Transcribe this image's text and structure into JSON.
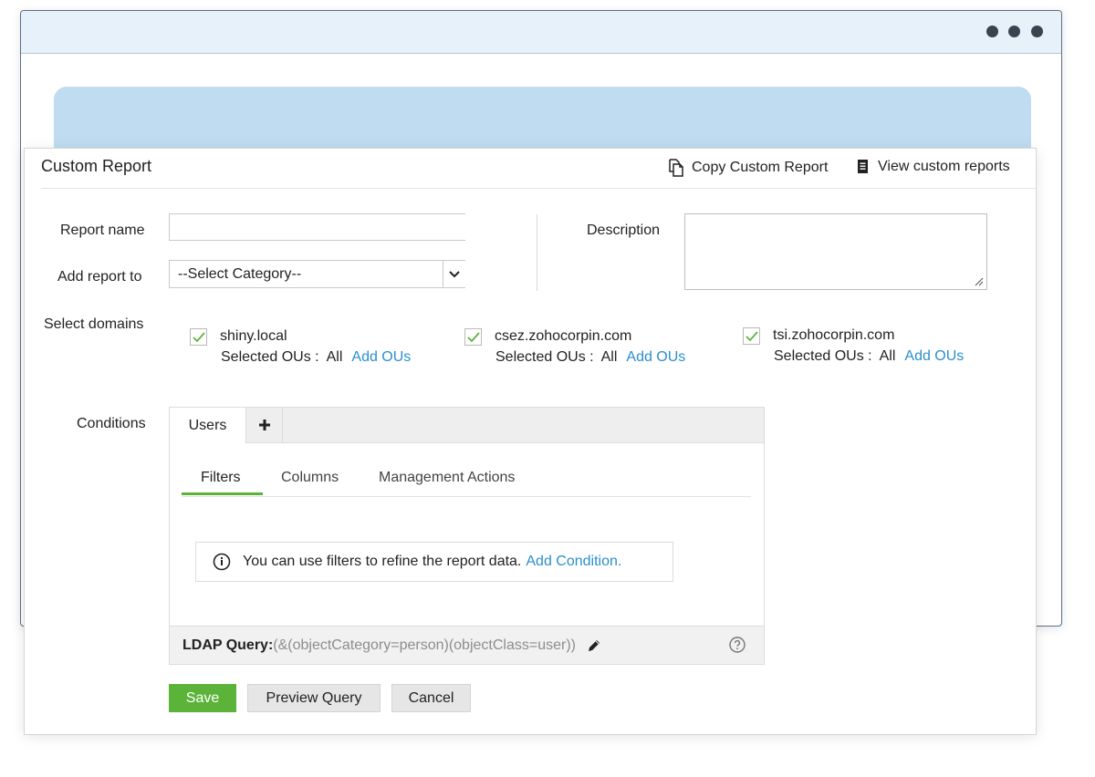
{
  "panel": {
    "title": "Custom Report",
    "copy_link": "Copy Custom Report",
    "view_link": "View custom reports"
  },
  "form": {
    "report_name_label": "Report name",
    "report_name_value": "",
    "add_report_label": "Add report to",
    "category_selected": "--Select Category--",
    "description_label": "Description",
    "description_value": "",
    "select_domains_label": "Select domains",
    "conditions_label": "Conditions"
  },
  "domains": [
    {
      "name": "shiny.local",
      "ou_label": "Selected OUs :",
      "ou_value": "All",
      "add_ous": "Add OUs",
      "checked": true
    },
    {
      "name": "csez.zohocorpin.com",
      "ou_label": "Selected OUs :",
      "ou_value": "All",
      "add_ous": "Add OUs",
      "checked": true
    },
    {
      "name": "tsi.zohocorpin.com",
      "ou_label": "Selected OUs :",
      "ou_value": "All",
      "add_ous": "Add OUs",
      "checked": true
    }
  ],
  "conditions": {
    "object_tab": "Users",
    "add_tab_icon": "plus-icon",
    "subtabs": [
      "Filters",
      "Columns",
      "Management Actions"
    ],
    "active_subtab": "Filters",
    "info_text": "You can use filters to refine the report data.",
    "add_condition": "Add Condition.",
    "ldap_label": "LDAP Query:",
    "ldap_value": "(&(objectCategory=person)(objectClass=user))"
  },
  "buttons": {
    "save": "Save",
    "preview": "Preview Query",
    "cancel": "Cancel"
  },
  "colors": {
    "accent_green": "#5cb33a",
    "link_blue": "#2b8fcc",
    "banner_blue": "#bfdcf0"
  }
}
